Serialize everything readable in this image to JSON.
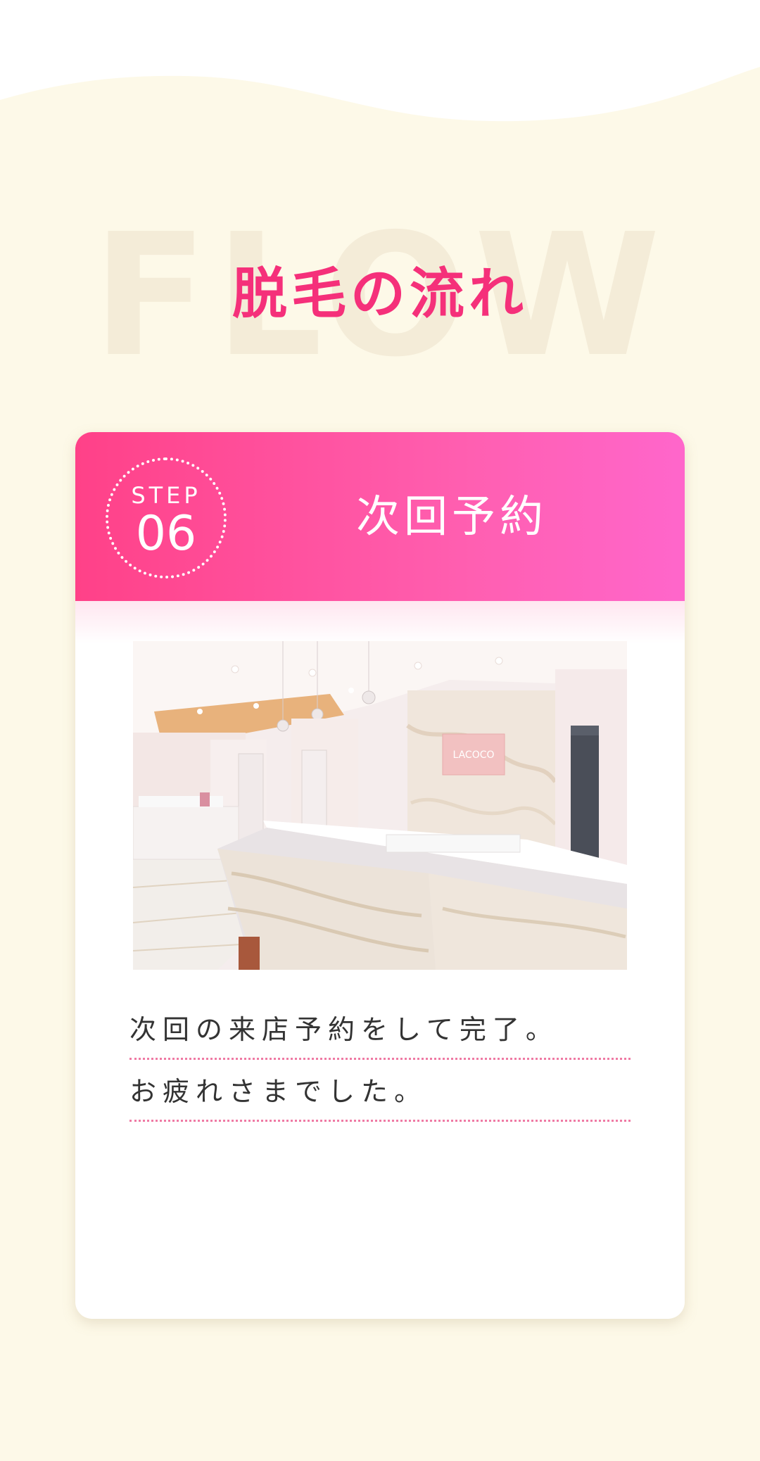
{
  "section": {
    "background_word": "FLOW",
    "title": "脱毛の流れ"
  },
  "step": {
    "label": "STEP",
    "number": "06",
    "title": "次回予約"
  },
  "photo": {
    "sign_text": "LACOCO"
  },
  "description": {
    "lines": [
      "次回の来店予約をして完了。",
      "お疲れさまでした。"
    ]
  },
  "colors": {
    "page_background": "#fdf9e8",
    "accent_pink": "#f5307a",
    "header_gradient_start": "#ff4188",
    "header_gradient_end": "#ff66cb",
    "divider_pink": "#ef7aa4"
  }
}
